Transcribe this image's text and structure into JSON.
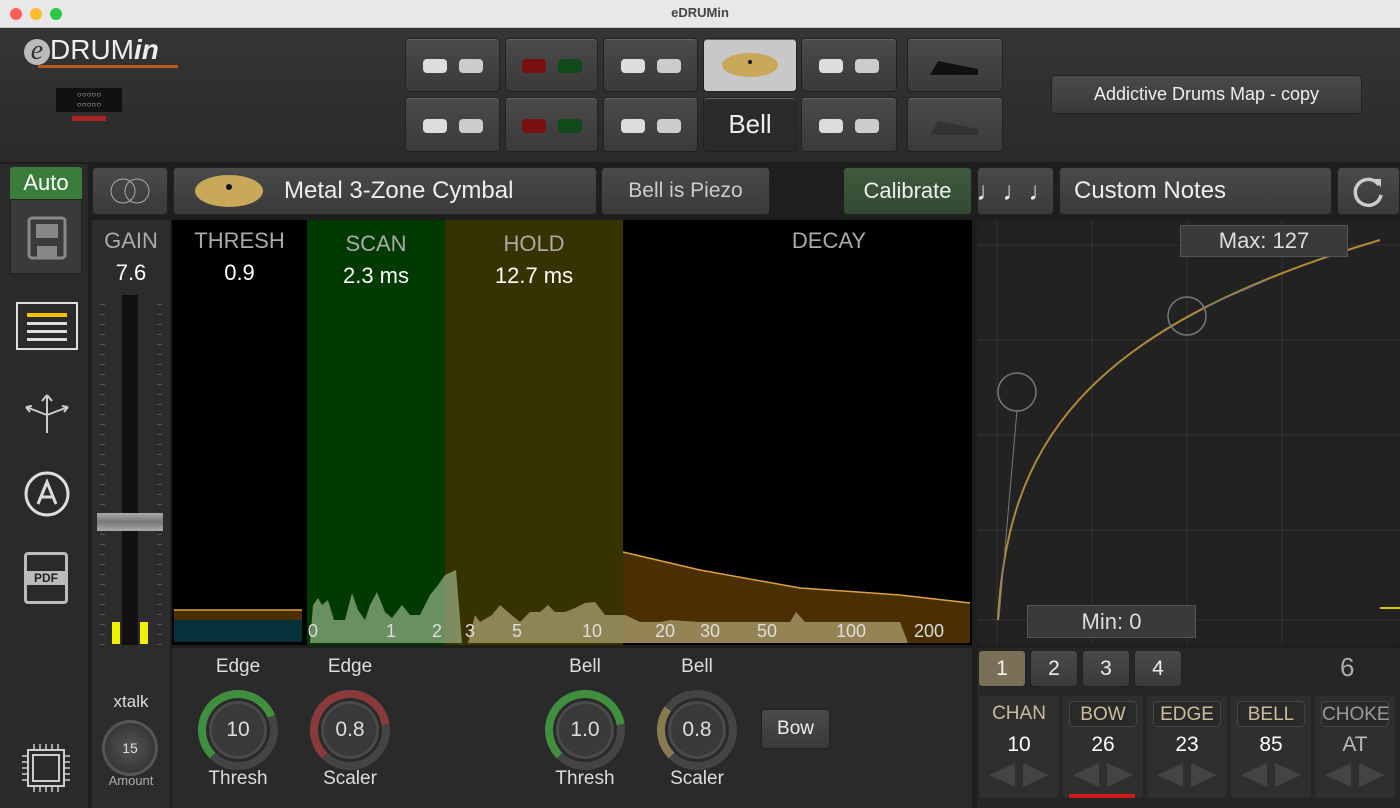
{
  "window": {
    "title": "eDRUMin"
  },
  "logo": {
    "text": "eDRUMin"
  },
  "preset": {
    "label": "Addictive Drums Map - copy"
  },
  "pads": {
    "bell_label": "Bell"
  },
  "sidebar": {
    "auto_label": "Auto",
    "items": [
      "save-icon",
      "list-icon",
      "routing-icon",
      "a-circle-icon",
      "pdf-icon",
      "chip-icon"
    ],
    "pdf_text": "PDF"
  },
  "toolbar": {
    "pad_name": "Metal 3-Zone Cymbal",
    "bell_piezo": "Bell is Piezo",
    "calibrate": "Calibrate",
    "notes": "Custom Notes"
  },
  "gain": {
    "label": "GAIN",
    "value": "7.6"
  },
  "graph": {
    "thresh": {
      "label": "THRESH",
      "value": "0.9"
    },
    "scan": {
      "label": "SCAN",
      "value": "2.3 ms"
    },
    "hold": {
      "label": "HOLD",
      "value": "12.7 ms"
    },
    "decay": {
      "label": "DECAY"
    },
    "ticks": [
      "0",
      "1",
      "2",
      "3",
      "5",
      "10",
      "20",
      "30",
      "50",
      "100",
      "200"
    ]
  },
  "curve": {
    "max": "Max: 127",
    "min": "Min: 0"
  },
  "xtalk": {
    "label": "xtalk",
    "value": "15",
    "sub": "Amount"
  },
  "knobs": [
    {
      "top": "Edge",
      "value": "10",
      "bottom": "Thresh",
      "color": "#3f8f3f",
      "level": 0.75
    },
    {
      "top": "Edge",
      "value": "0.8",
      "bottom": "Scaler",
      "color": "#8a3a3a",
      "level": 0.8
    },
    {
      "top": "Bell",
      "value": "1.0",
      "bottom": "Thresh",
      "color": "#3f8f3f",
      "level": 0.8
    },
    {
      "top": "Bell",
      "value": "0.8",
      "bottom": "Scaler",
      "color": "#8a7a50",
      "level": 0.3
    }
  ],
  "bow_button": "Bow",
  "zones": {
    "tabs": [
      "1",
      "2",
      "3",
      "4"
    ],
    "active": "1",
    "count": "6",
    "cells": [
      {
        "h": "CHAN",
        "v": "10"
      },
      {
        "h": "BOW",
        "v": "26"
      },
      {
        "h": "EDGE",
        "v": "23"
      },
      {
        "h": "BELL",
        "v": "85"
      },
      {
        "h": "CHOKE",
        "v": "AT"
      }
    ]
  }
}
